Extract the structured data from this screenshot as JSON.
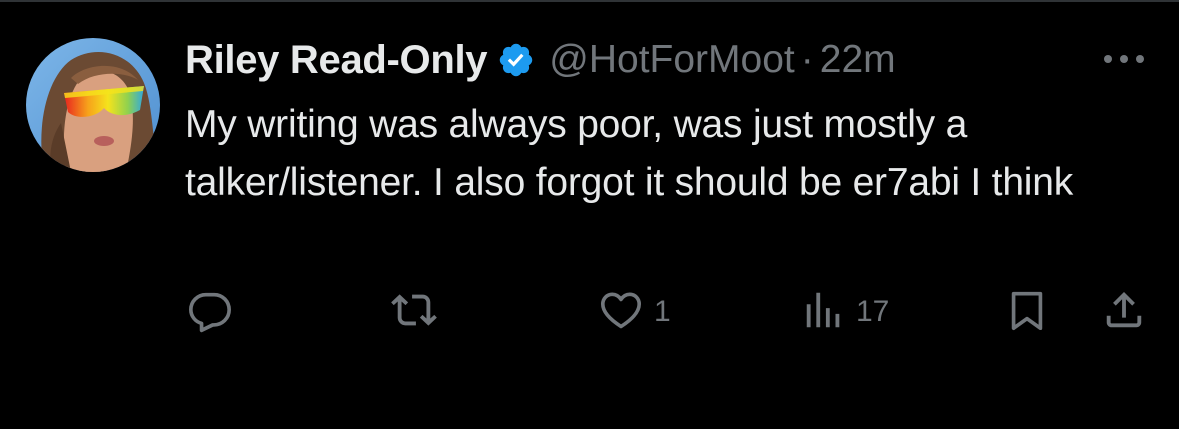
{
  "tweet": {
    "author": {
      "display_name": "Riley Read-Only",
      "verified": true,
      "handle": "@HotForMoot"
    },
    "separator": "·",
    "time": "22m",
    "text": "My writing was always poor, was just mostly a talker/listener. I also forgot it should be er7abi I think",
    "actions": {
      "reply_count": "",
      "retweet_count": "",
      "like_count": "1",
      "view_count": "17"
    }
  },
  "icons": {
    "verified": "verified-badge-icon",
    "more": "more-icon",
    "reply": "reply-icon",
    "retweet": "retweet-icon",
    "like": "heart-icon",
    "views": "views-icon",
    "bookmark": "bookmark-icon",
    "share": "share-icon"
  },
  "colors": {
    "background": "#000000",
    "text": "#e7e9ea",
    "secondary_text": "#71767b",
    "verified_blue": "#1d9bf0",
    "divider": "#2f3336"
  }
}
